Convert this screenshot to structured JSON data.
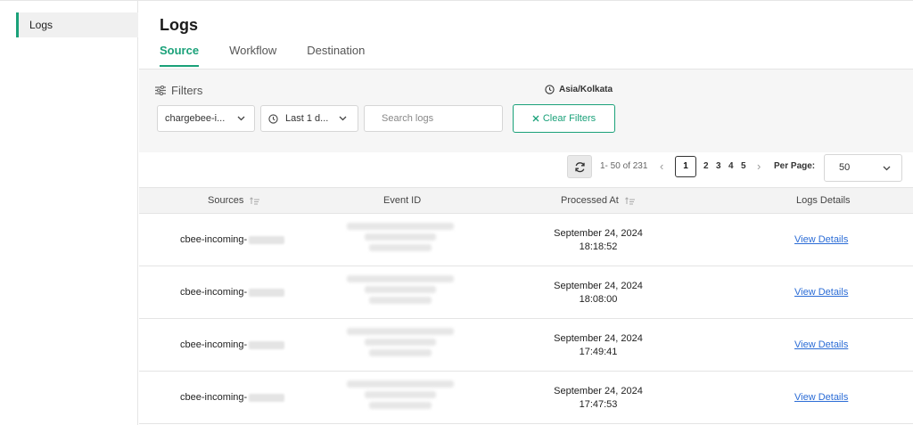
{
  "sidebar": {
    "items": [
      {
        "label": "Logs"
      }
    ]
  },
  "header": {
    "title": "Logs"
  },
  "tabs": [
    {
      "label": "Source",
      "active": true
    },
    {
      "label": "Workflow",
      "active": false
    },
    {
      "label": "Destination",
      "active": false
    }
  ],
  "filters": {
    "label": "Filters",
    "timezone": "Asia/Kolkata",
    "source_select": "chargebee-i...",
    "time_select": "Last 1 d...",
    "search_placeholder": "Search logs",
    "clear_label": "Clear Filters"
  },
  "pagination": {
    "range": "1- 50 of 231",
    "pages": [
      "1",
      "2",
      "3",
      "4",
      "5"
    ],
    "current_page": "1",
    "per_page_label": "Per Page:",
    "per_page_value": "50"
  },
  "table": {
    "columns": [
      "Sources",
      "Event ID",
      "Processed At",
      "Logs Details"
    ],
    "rows": [
      {
        "source": "cbee-incoming-",
        "date": "September 24, 2024",
        "time": "18:18:52",
        "link": "View Details"
      },
      {
        "source": "cbee-incoming-",
        "date": "September 24, 2024",
        "time": "18:08:00",
        "link": "View Details"
      },
      {
        "source": "cbee-incoming-",
        "date": "September 24, 2024",
        "time": "17:49:41",
        "link": "View Details"
      },
      {
        "source": "cbee-incoming-",
        "date": "September 24, 2024",
        "time": "17:47:53",
        "link": "View Details"
      }
    ]
  },
  "colors": {
    "accent": "#1aa179",
    "link": "#2b6cd6"
  }
}
